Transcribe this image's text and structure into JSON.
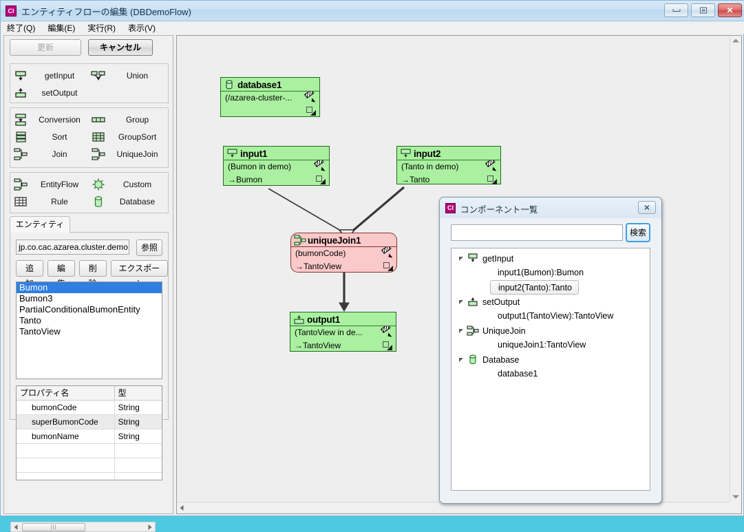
{
  "window": {
    "title": "エンティティフローの編集 (DBDemoFlow)",
    "app_icon": "ci-app-icon",
    "icon_label": "CI",
    "buttons": {
      "minimize": "minimize-icon",
      "maximize": "maximize-icon",
      "close": "✕"
    }
  },
  "menubar": {
    "items": [
      {
        "label": "終了(Q)"
      },
      {
        "label": "編集(E)"
      },
      {
        "label": "実行(R)"
      },
      {
        "label": "表示(V)"
      }
    ]
  },
  "left_panel": {
    "actions": {
      "update": "更新",
      "cancel": "キャンセル"
    },
    "palette_groups": [
      {
        "name": "io-group",
        "items": [
          {
            "label": "getInput",
            "icon": "get-input-icon"
          },
          {
            "label": "Union",
            "icon": "union-icon"
          },
          {
            "label": "setOutput",
            "icon": "set-output-icon"
          },
          {
            "label": "",
            "icon": ""
          }
        ]
      },
      {
        "name": "transform-group",
        "items": [
          {
            "label": "Conversion",
            "icon": "conversion-icon"
          },
          {
            "label": "Group",
            "icon": "group-icon"
          },
          {
            "label": "Sort",
            "icon": "sort-icon"
          },
          {
            "label": "GroupSort",
            "icon": "group-sort-icon"
          },
          {
            "label": "Join",
            "icon": "join-icon"
          },
          {
            "label": "UniqueJoin",
            "icon": "unique-join-icon"
          }
        ]
      },
      {
        "name": "source-group",
        "items": [
          {
            "label": "EntityFlow",
            "icon": "entity-flow-icon"
          },
          {
            "label": "Custom",
            "icon": "custom-gear-icon"
          },
          {
            "label": "Rule",
            "icon": "rule-table-icon"
          },
          {
            "label": "Database",
            "icon": "database-cylinder-icon"
          }
        ]
      }
    ],
    "entity_tab": {
      "label": "エンティティ",
      "package_field_value": "jp.co.cac.azarea.cluster.demo",
      "browse_button": "参照",
      "buttons": [
        "追加",
        "編集",
        "削除",
        "エクスポート"
      ],
      "entity_list": [
        {
          "label": "Bumon",
          "selected": true
        },
        {
          "label": "Bumon3",
          "selected": false
        },
        {
          "label": "PartialConditionalBumonEntity",
          "selected": false
        },
        {
          "label": "Tanto",
          "selected": false
        },
        {
          "label": "TantoView",
          "selected": false
        }
      ],
      "property_table": {
        "columns": [
          "プロパティ名",
          "型"
        ],
        "rows": [
          {
            "name": "bumonCode",
            "type": "String",
            "highlighted": false
          },
          {
            "name": "superBumonCode",
            "type": "String",
            "highlighted": true
          },
          {
            "name": "bumonName",
            "type": "String",
            "highlighted": false
          },
          {
            "name": "",
            "type": "",
            "highlighted": false
          },
          {
            "name": "",
            "type": "",
            "highlighted": false
          },
          {
            "name": "",
            "type": "",
            "highlighted": false
          }
        ]
      }
    }
  },
  "canvas": {
    "nodes": [
      {
        "id": "database1",
        "title": "database1",
        "icon": "database-cylinder-icon",
        "line1": "(/azarea-cluster-...",
        "line2": "",
        "color": "#aaf0a0",
        "shape": "rect"
      },
      {
        "id": "input1",
        "title": "input1",
        "icon": "get-input-icon",
        "line1": "(Bumon in demo)",
        "line2": "→Bumon",
        "color": "#aaf0a0",
        "shape": "rect"
      },
      {
        "id": "input2",
        "title": "input2",
        "icon": "get-input-icon",
        "line1": "(Tanto in demo)",
        "line2": "→Tanto",
        "color": "#aaf0a0",
        "shape": "rect"
      },
      {
        "id": "uniqueJoin1",
        "title": "uniqueJoin1",
        "icon": "unique-join-icon",
        "line1": "(bumonCode)",
        "line2": "→TantoView",
        "color": "#fbc9c9",
        "shape": "rounded"
      },
      {
        "id": "output1",
        "title": "output1",
        "icon": "set-output-icon",
        "line1": "(TantoView in de...",
        "line2": "→TantoView",
        "color": "#aaf0a0",
        "shape": "rect"
      }
    ]
  },
  "component_dialog": {
    "icon_label": "CI",
    "title": "コンポーネント一覧",
    "close_label": "✕",
    "search_value": "",
    "search_placeholder": "",
    "search_button": "検索",
    "tree": [
      {
        "label": "getInput",
        "icon": "get-input-icon",
        "expanded": true,
        "children": [
          {
            "label": "input1(Bumon):Bumon",
            "selected": false
          },
          {
            "label": "input2(Tanto):Tanto",
            "selected": true
          }
        ]
      },
      {
        "label": "setOutput",
        "icon": "set-output-icon",
        "expanded": true,
        "children": [
          {
            "label": "output1(TantoView):TantoView",
            "selected": false
          }
        ]
      },
      {
        "label": "UniqueJoin",
        "icon": "unique-join-icon",
        "expanded": true,
        "children": [
          {
            "label": "uniqueJoin1:TantoView",
            "selected": false
          }
        ]
      },
      {
        "label": "Database",
        "icon": "database-cylinder-icon",
        "expanded": true,
        "children": [
          {
            "label": "database1",
            "selected": false
          }
        ]
      }
    ]
  },
  "colors": {
    "node_green": "#aaf0a0",
    "node_pink": "#fbc9c9",
    "selection_blue": "#2f7fe0",
    "accent_blue": "#3f9fe0",
    "desktop": "#4ec9e0"
  }
}
